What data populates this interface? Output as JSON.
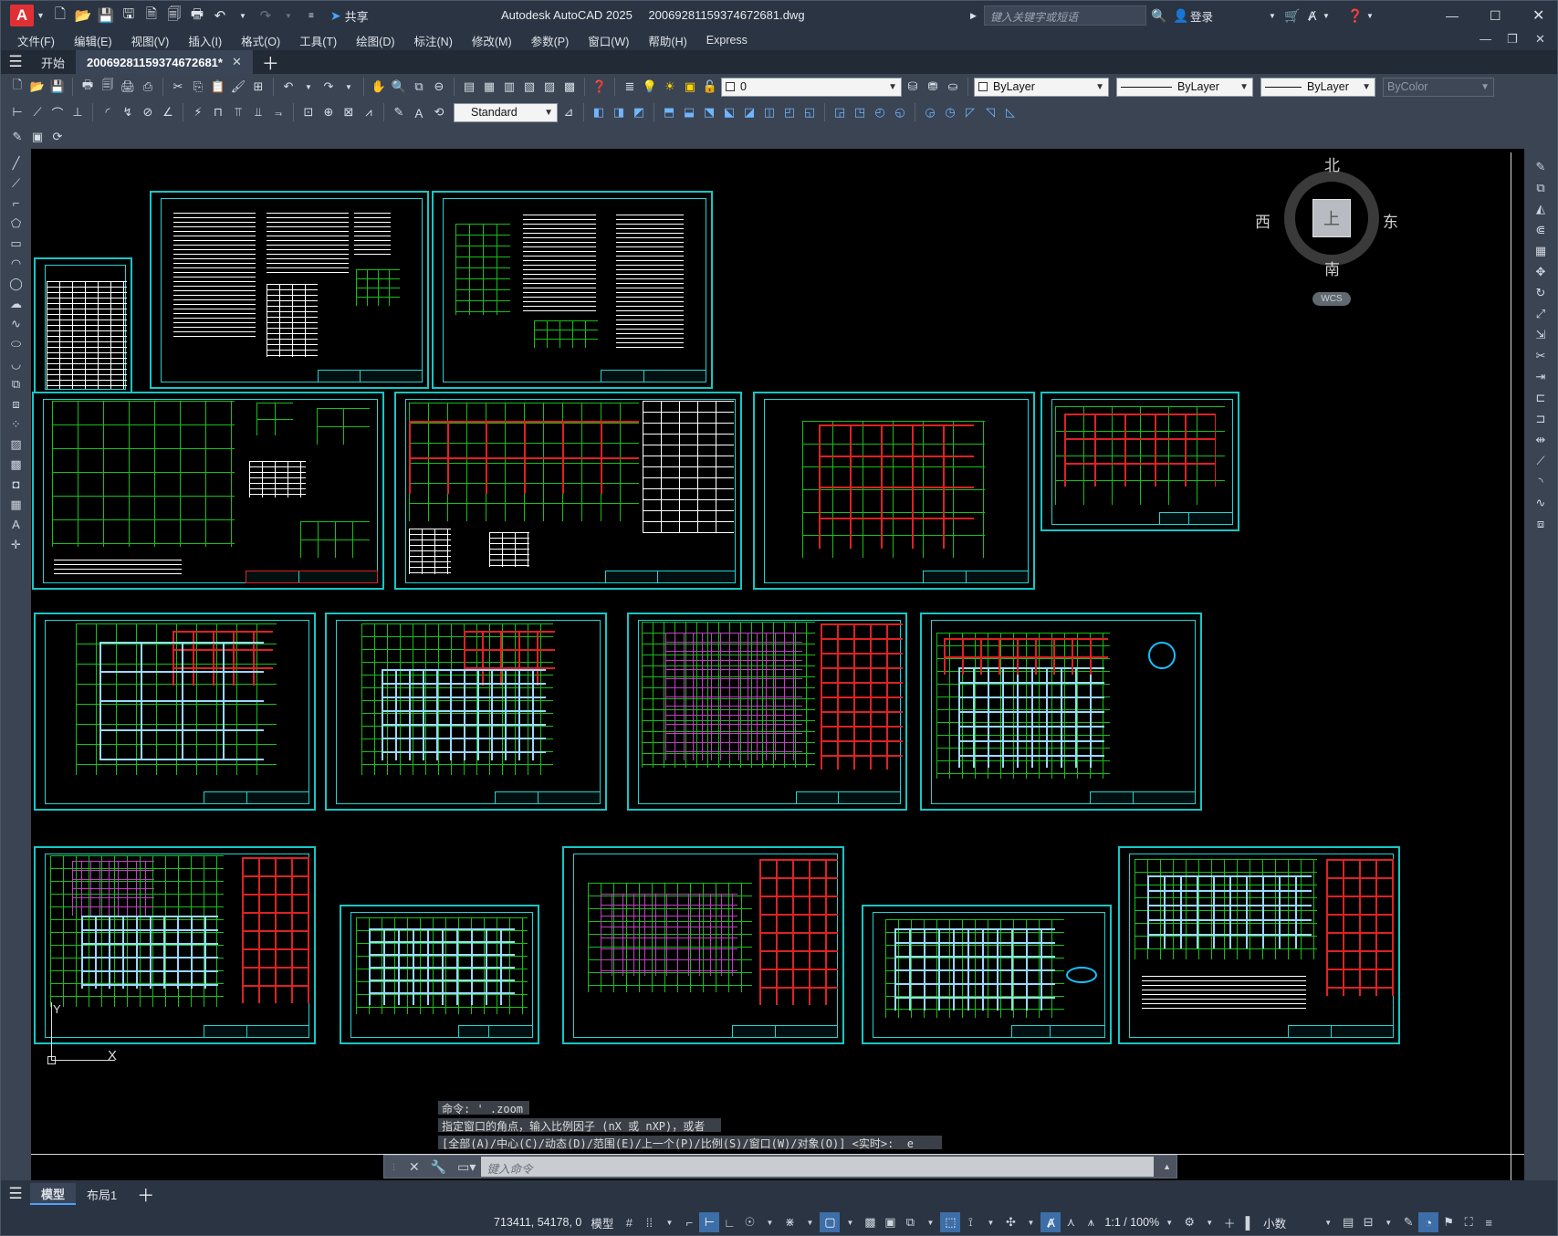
{
  "app": {
    "logo": "A",
    "title": "Autodesk AutoCAD 2025",
    "filename": "20069281159374672681.dwg",
    "share": "共享",
    "search_placeholder": "键入关键字或短语",
    "login": "登录"
  },
  "menu": [
    "文件(F)",
    "编辑(E)",
    "视图(V)",
    "插入(I)",
    "格式(O)",
    "工具(T)",
    "绘图(D)",
    "标注(N)",
    "修改(M)",
    "参数(P)",
    "窗口(W)",
    "帮助(H)",
    "Express"
  ],
  "tabs": {
    "start": "开始",
    "doc": "20069281159374672681*"
  },
  "toolbar": {
    "layer_value": "0",
    "color_value": "ByLayer",
    "linetype_value": "ByLayer",
    "lineweight_value": "ByLayer",
    "plotstyle_value": "ByColor",
    "textstyle_value": "Standard"
  },
  "viewcube": {
    "north": "北",
    "south": "南",
    "west": "西",
    "east": "东",
    "face": "上",
    "wcs": "WCS"
  },
  "ucs": {
    "x": "X",
    "y": "Y"
  },
  "command": {
    "history": [
      "命令: '_.zoom",
      "指定窗口的角点，输入比例因子 (nX 或 nXP)，或者",
      "[全部(A)/中心(C)/动态(D)/范围(E)/上一个(P)/比例(S)/窗口(W)/对象(O)] <实时>: _e"
    ],
    "placeholder": "键入命令"
  },
  "layout_tabs": [
    "模型",
    "布局1"
  ],
  "status": {
    "coords": "713411, 54178, 0",
    "space": "模型",
    "scale": "1:1 / 100%",
    "units": "小数"
  },
  "colors": {
    "accent": "#4aa3ff",
    "sheet_border": "#17c6c6",
    "grid_green": "#16c016",
    "grid_red": "#dd2222",
    "logo_red": "#e03035"
  }
}
